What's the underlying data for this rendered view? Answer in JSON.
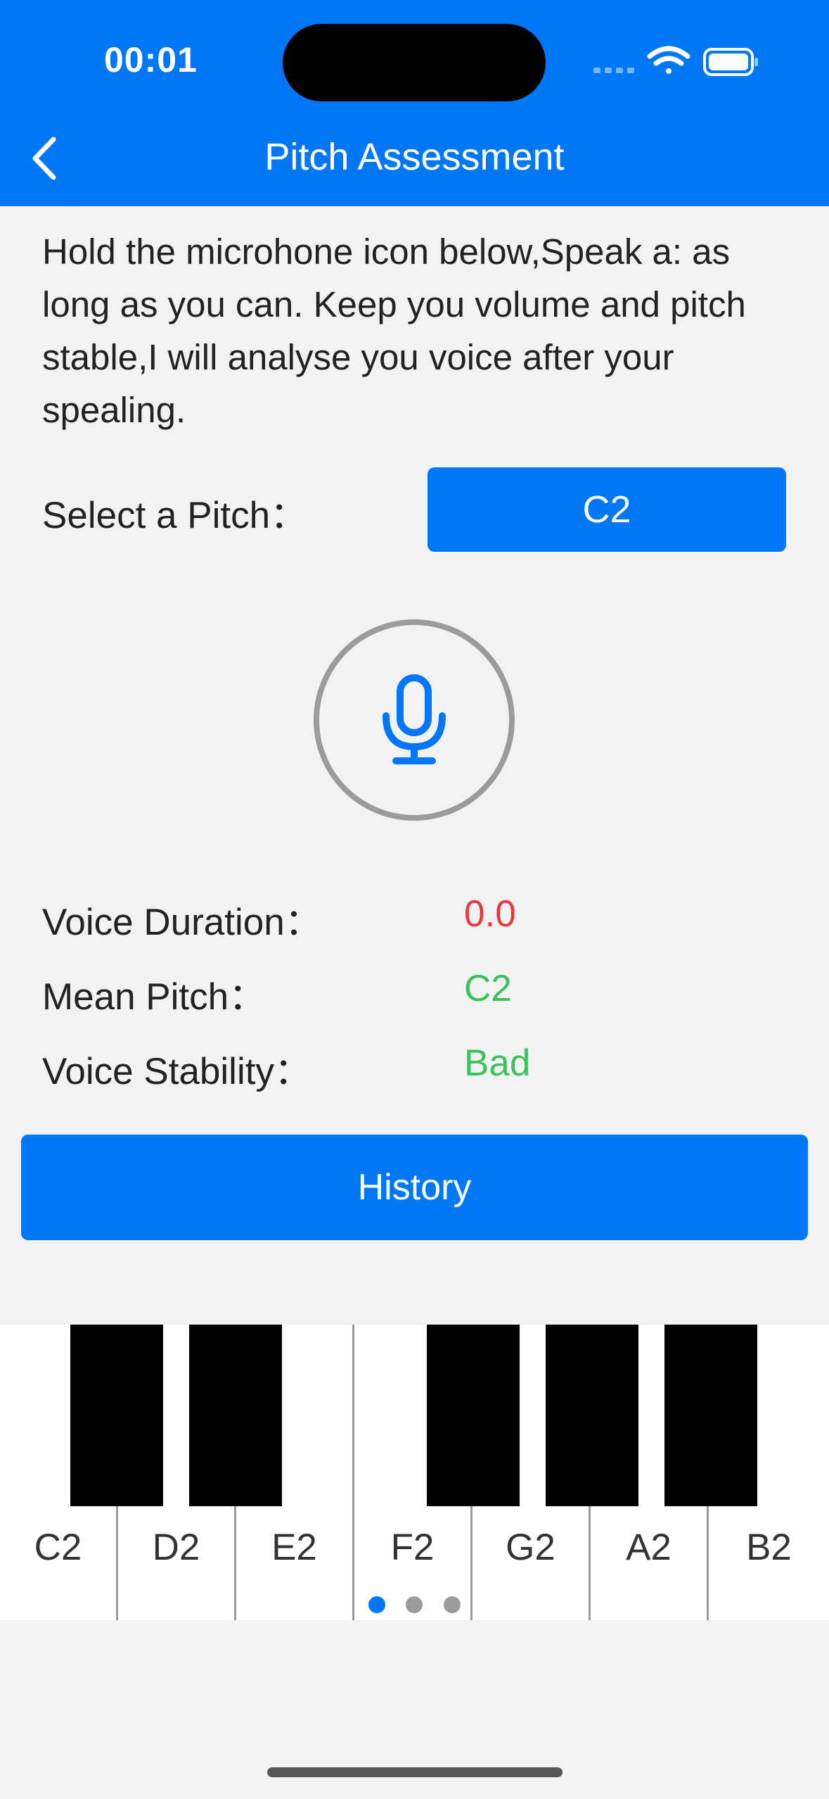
{
  "status_bar": {
    "time": "00:01"
  },
  "header": {
    "title": "Pitch Assessment"
  },
  "instructions": "Hold the microhone icon below,Speak a: as long as you can. Keep you volume and pitch stable,I will analyse you voice after your spealing.",
  "pitch_select": {
    "label": "Select a Pitch：",
    "value": "C2"
  },
  "stats": {
    "duration_label": "Voice Duration：",
    "duration_value": "0.0",
    "mean_pitch_label": "Mean Pitch：",
    "mean_pitch_value": "C2",
    "stability_label": "Voice Stability：",
    "stability_value": "Bad"
  },
  "history_button": "History",
  "piano": {
    "keys": [
      "C2",
      "D2",
      "E2",
      "F2",
      "G2",
      "A2",
      "B2"
    ]
  },
  "pager": {
    "count": 3,
    "active": 1
  },
  "colors": {
    "accent": "#0077f7",
    "duration_value": "#e8383d",
    "good_value": "#3cc25a",
    "mic_icon": "#0077f7"
  }
}
